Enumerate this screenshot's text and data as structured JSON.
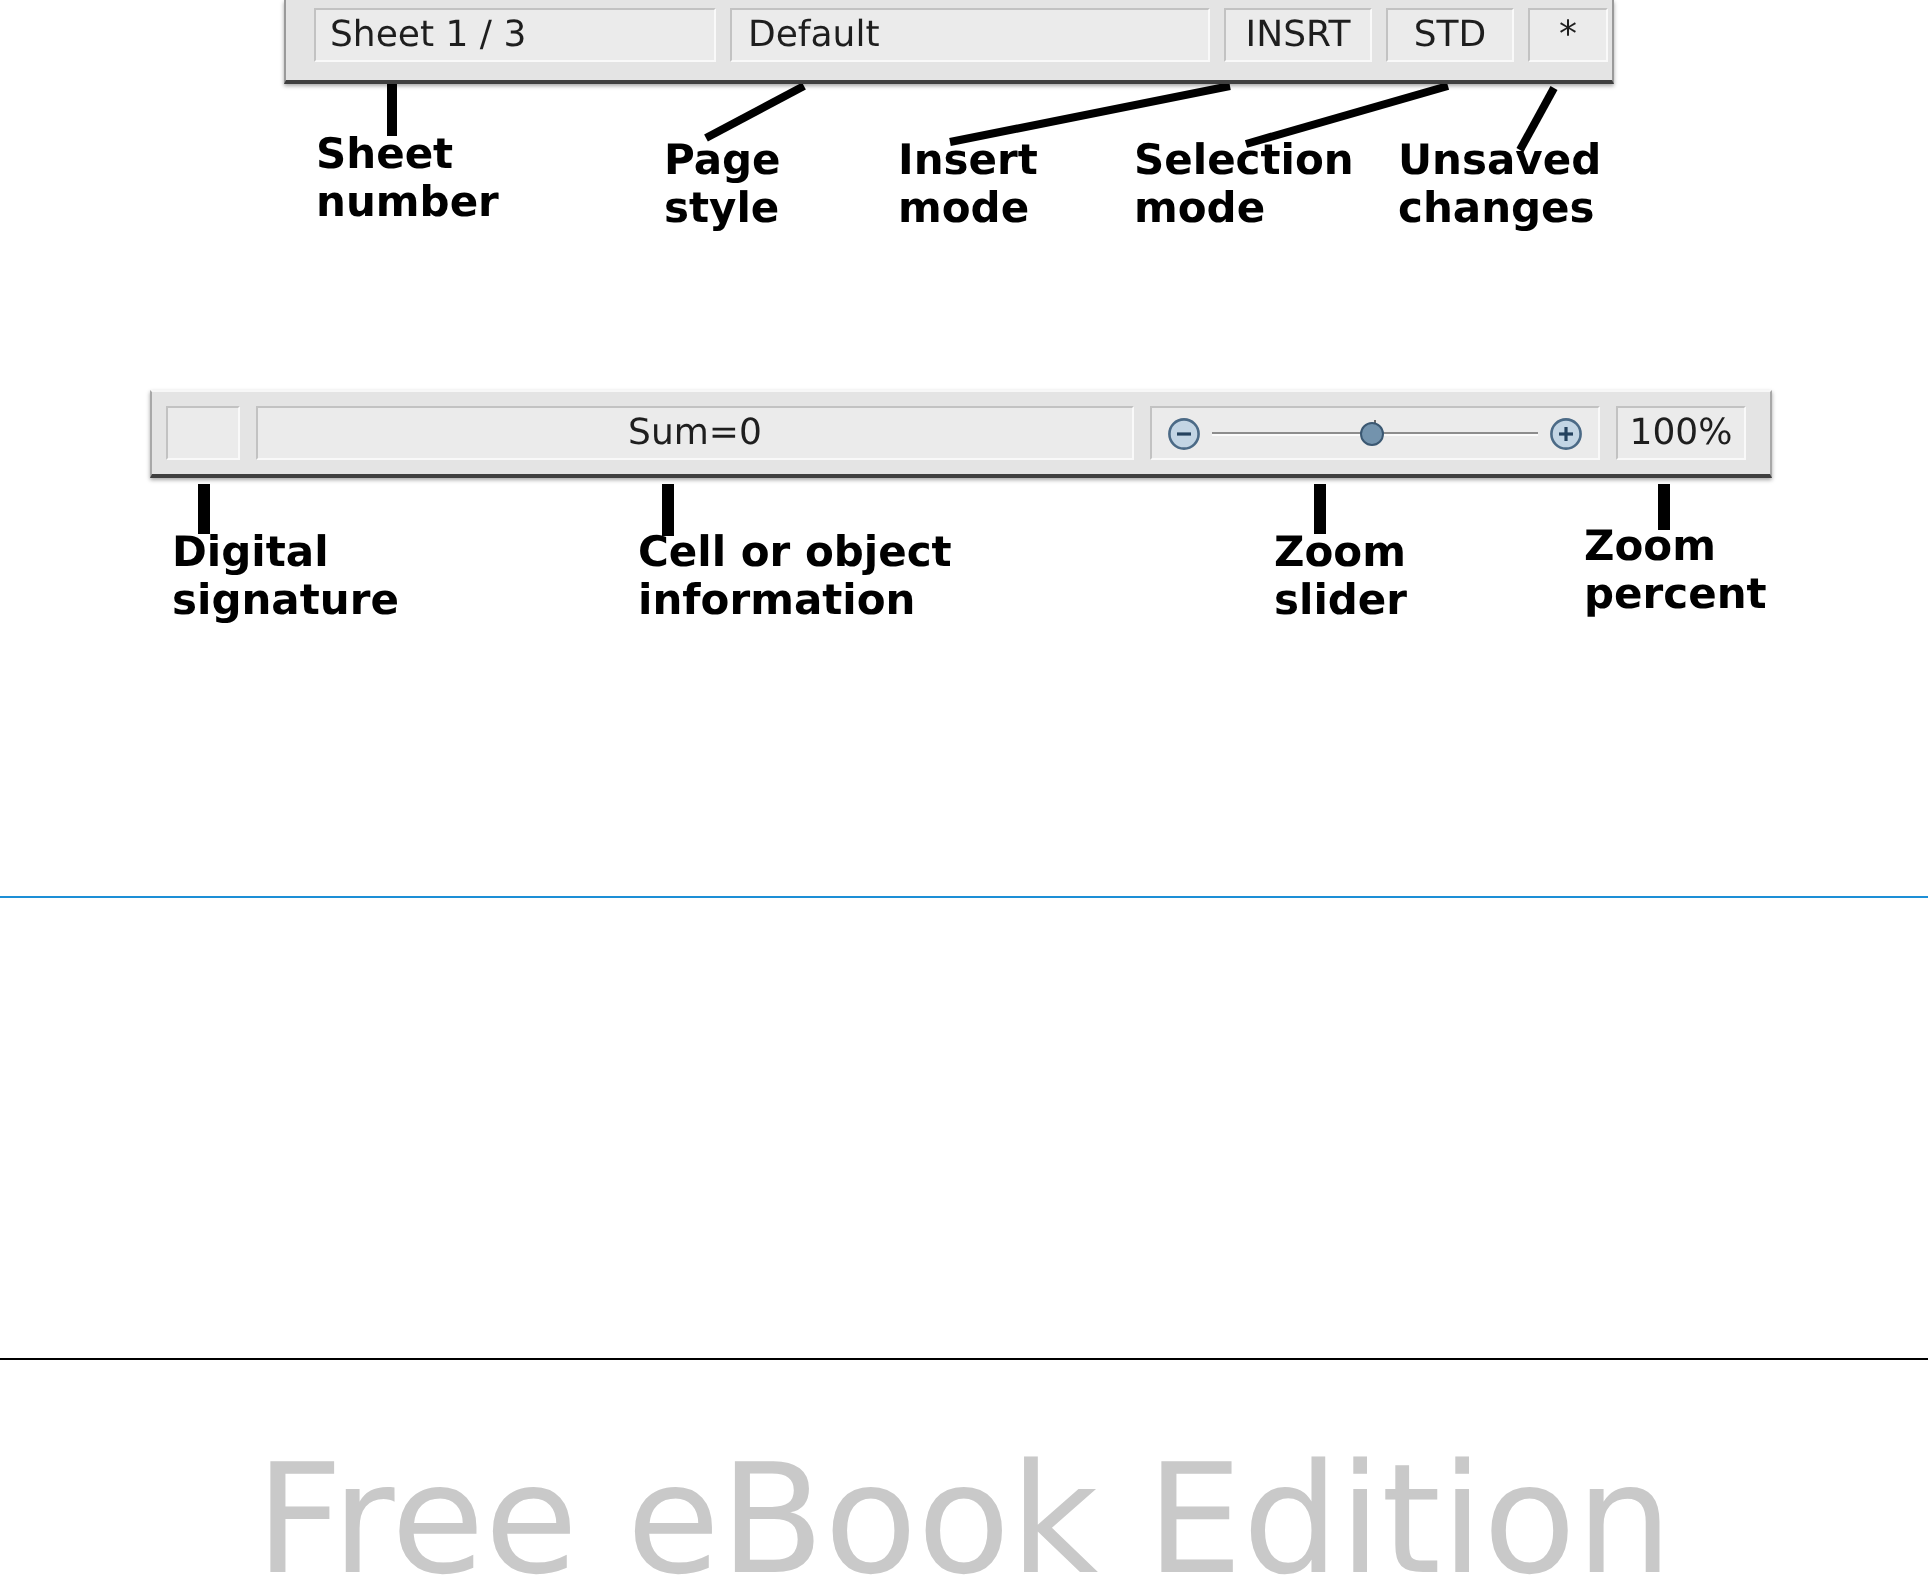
{
  "figures": [
    {
      "status_bar": {
        "fields": [
          {
            "kind": "text",
            "text": "Sheet 1 / 3"
          },
          {
            "kind": "text",
            "text": "Default"
          },
          {
            "kind": "text",
            "text": "INSRT"
          },
          {
            "kind": "text",
            "text": "STD"
          },
          {
            "kind": "text",
            "text": "*"
          }
        ]
      },
      "callouts": [
        {
          "label": "Sheet\nnumber"
        },
        {
          "label": "Page\nstyle"
        },
        {
          "label": "Insert\nmode"
        },
        {
          "label": "Selection\nmode"
        },
        {
          "label": "Unsaved\nchanges"
        }
      ]
    },
    {
      "status_bar": {
        "fields": [
          {
            "kind": "empty"
          },
          {
            "kind": "text",
            "text": "Sum=0"
          },
          {
            "kind": "zoom_slider",
            "level": 0.49
          },
          {
            "kind": "text",
            "text": "100%"
          }
        ]
      },
      "callouts": [
        {
          "label": "Digital\nsignature"
        },
        {
          "label": "Cell or object\ninformation"
        },
        {
          "label": "Zoom\nslider"
        },
        {
          "label": "Zoom\npercent"
        }
      ]
    }
  ],
  "footer": {
    "text": "Free eBook Edition"
  }
}
